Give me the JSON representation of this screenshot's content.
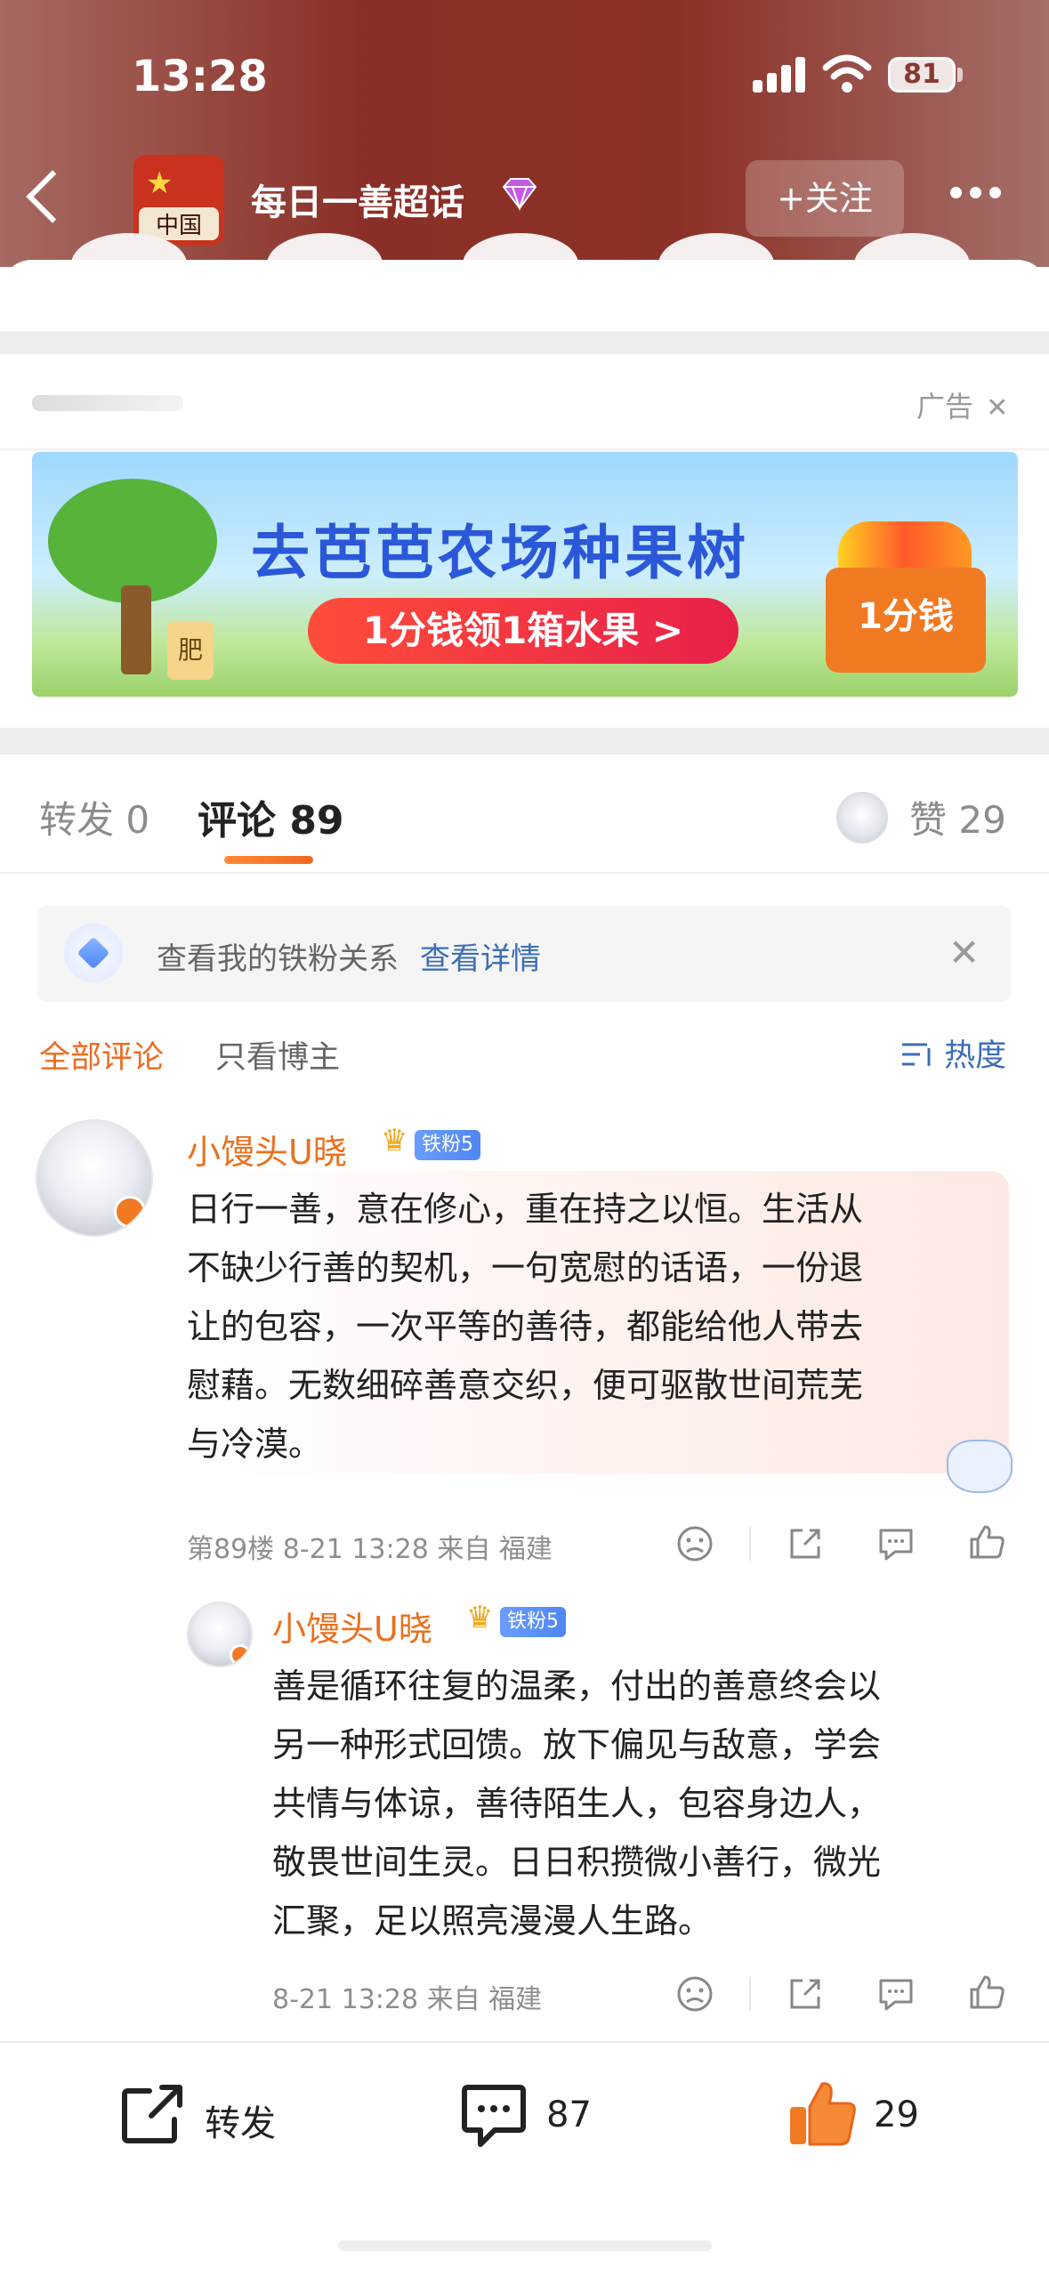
{
  "status_bar": {
    "time": "13:28",
    "battery": "81"
  },
  "topic": {
    "avatar_text": "中国",
    "title": "每日一善超话",
    "follow_label": "+关注"
  },
  "ad": {
    "label": "广告",
    "close": "✕",
    "banner_title": "去芭芭农场种果树",
    "banner_cta": "1分钱领1箱水果 >",
    "banner_box": "1分钱",
    "tree_bucket": "肥"
  },
  "tabs": {
    "repost": "转发 0",
    "comment": "评论 89",
    "like": "赞 29"
  },
  "fan_notice": {
    "text": "查看我的铁粉关系",
    "link": "查看详情",
    "close": "✕"
  },
  "filters": {
    "all": "全部评论",
    "blogger_only": "只看博主",
    "sort": "热度"
  },
  "comments": [
    {
      "user": "小馒头U晓",
      "badge": "铁粉5",
      "text": "日行一善，意在修心，重在持之以恒。生活从\n不缺少行善的契机，一句宽慰的话语，一份退\n让的包容，一次平等的善待，都能给他人带去\n慰藉。无数细碎善意交织，便可驱散世间荒芜\n与冷漠。",
      "meta": "第89楼 8-21 13:28 来自 福建"
    },
    {
      "user": "小馒头U晓",
      "badge": "铁粉5",
      "text": "善是循环往复的温柔，付出的善意终会以\n另一种形式回馈。放下偏见与敌意，学会\n共情与体谅，善待陌生人，包容身边人，\n敬畏世间生灵。日日积攒微小善行，微光\n汇聚，足以照亮漫漫人生路。",
      "meta": "8-21 13:28 来自 福建"
    }
  ],
  "bottom_bar": {
    "repost": "转发",
    "comment_count": "87",
    "like_count": "29"
  },
  "colors": {
    "accent_orange": "#f06a1f",
    "link_blue": "#3b6fb6",
    "header_red": "#8a2f27"
  }
}
